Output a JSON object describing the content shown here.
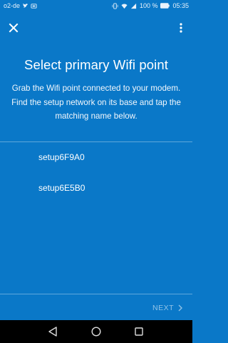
{
  "status_bar": {
    "carrier": "o2-de",
    "battery_percent": "100 %",
    "time": "05:35"
  },
  "app_bar": {
    "close_icon": "close-icon",
    "more_icon": "more-vertical-icon"
  },
  "main": {
    "title": "Select primary Wifi point",
    "description": "Grab the Wifi point connected to your modem. Find the setup network on its base and tap the matching name below.",
    "networks": [
      "setup6F9A0",
      "setup6E5B0"
    ]
  },
  "footer": {
    "next_label": "NEXT",
    "next_icon": "chevron-right-icon"
  },
  "nav_bar": {
    "icons": [
      "back-triangle-icon",
      "home-circle-icon",
      "recents-square-icon"
    ]
  },
  "colors": {
    "background": "#0a78c8",
    "nav_bar": "#000000",
    "text": "#ffffff"
  }
}
